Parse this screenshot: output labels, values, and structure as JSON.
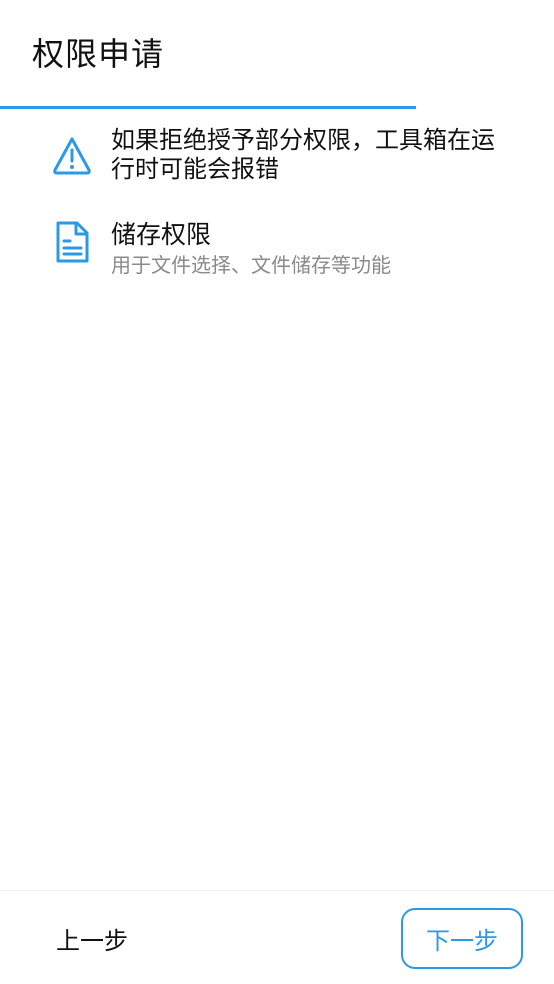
{
  "header": {
    "title": "权限申请",
    "progress": 0.75,
    "accent_color": "#2a9ae6"
  },
  "warning": {
    "icon": "warning-icon",
    "text": "如果拒绝授予部分权限，工具箱在运行时可能会报错"
  },
  "permissions": [
    {
      "icon": "document-icon",
      "name": "储存权限",
      "description": "用于文件选择、文件储存等功能"
    }
  ],
  "footer": {
    "prev_label": "上一步",
    "next_label": "下一步"
  }
}
